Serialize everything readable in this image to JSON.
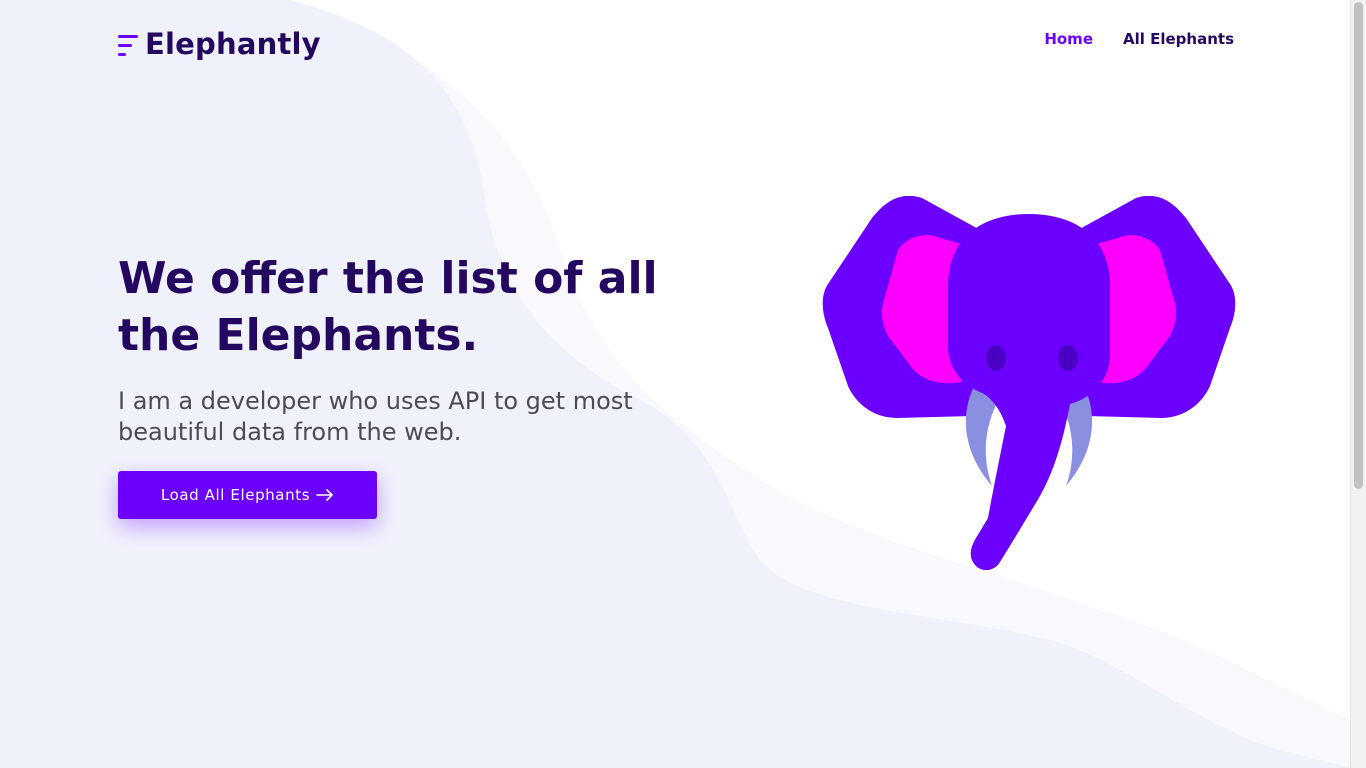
{
  "brand": {
    "name": "Elephantly",
    "logo_icon": "three-lines-logo-icon"
  },
  "nav": {
    "items": [
      {
        "label": "Home",
        "active": true
      },
      {
        "label": "All Elephants",
        "active": false
      }
    ]
  },
  "hero": {
    "title": "We offer the list of all the Elephants.",
    "subtitle": "I am a developer who uses API to get most beautiful data from the web.",
    "cta_label": "Load All Elephants",
    "cta_icon": "arrow-right-icon"
  },
  "illustration": {
    "name": "elephant-head-illustration"
  },
  "colors": {
    "primary": "#6b00ff",
    "heading": "#24075f",
    "ear_inner": "#ff00ff",
    "tusk": "#8a8fe0",
    "eye": "#4a00c2",
    "background_wave": "#f0f2fb"
  }
}
